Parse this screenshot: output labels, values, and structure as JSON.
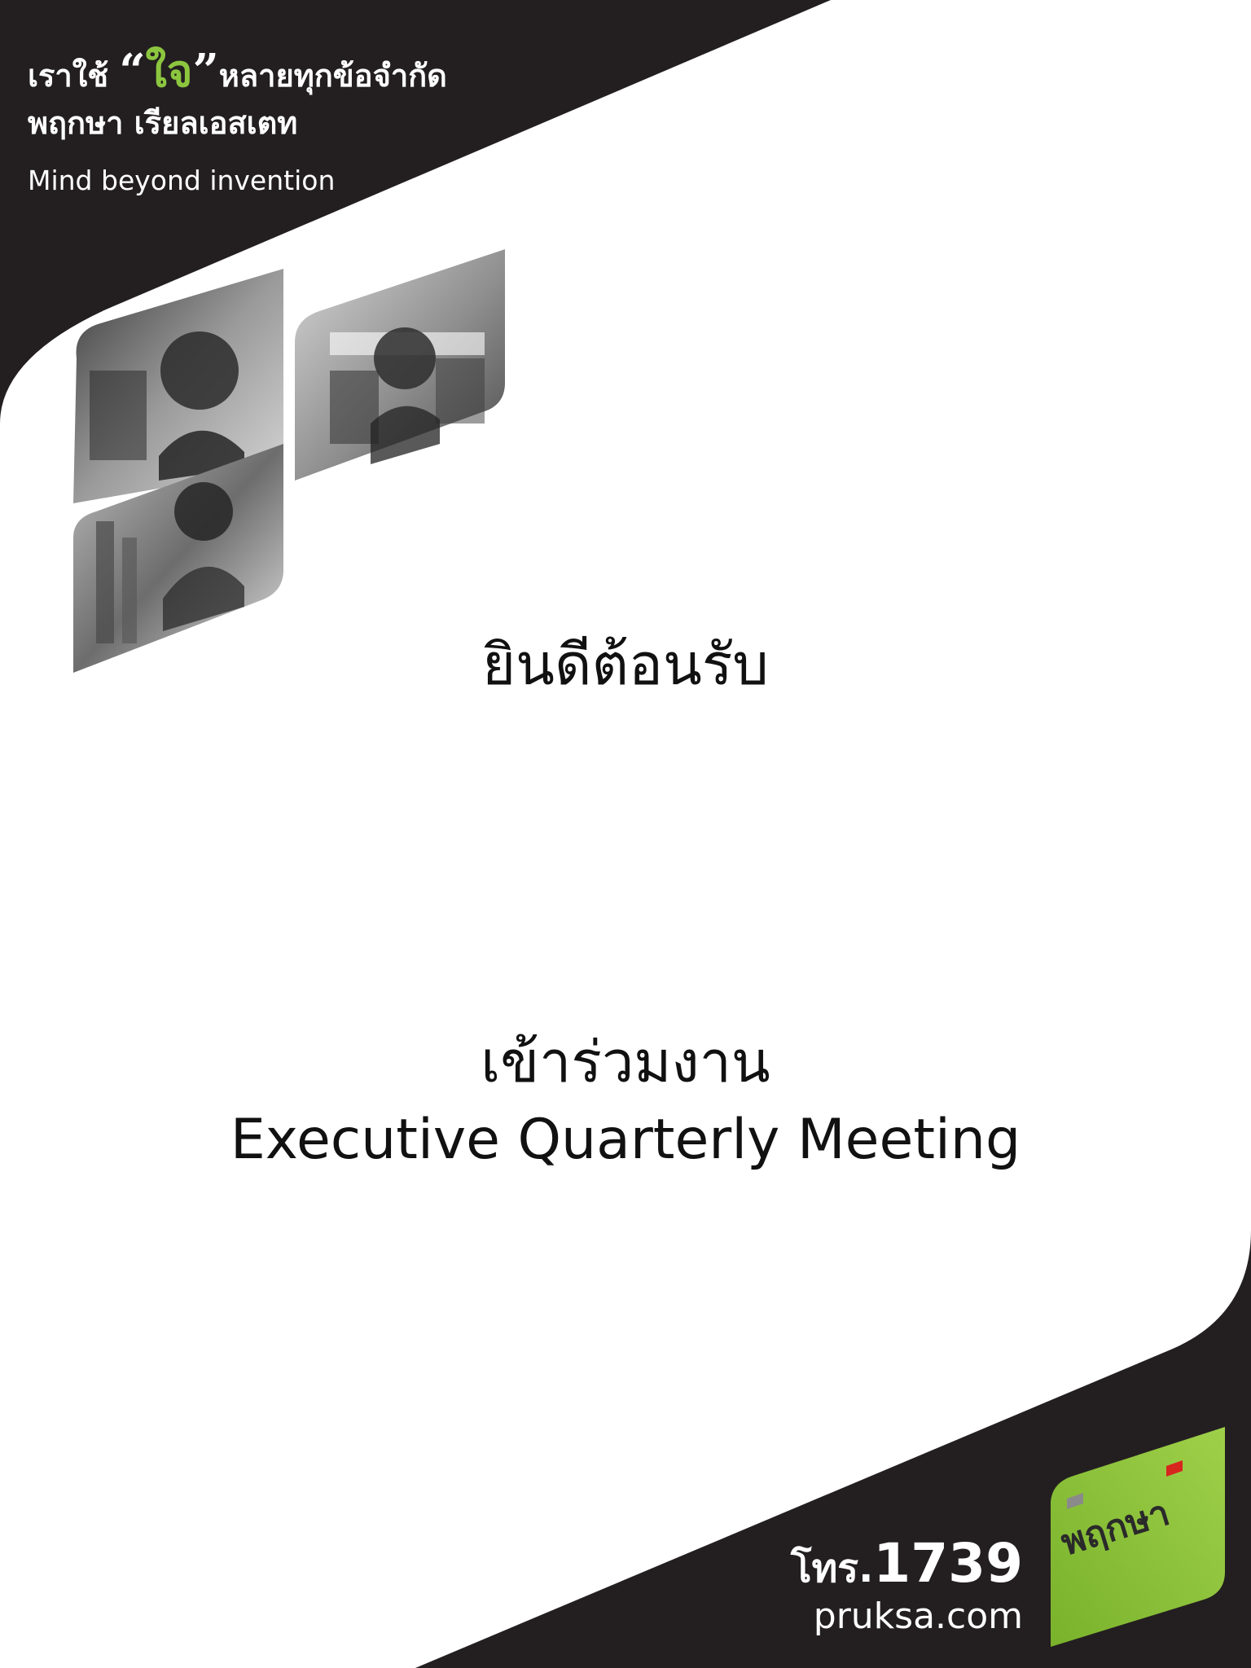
{
  "slogan": {
    "line1_before": "เราใช้",
    "open_quote": "“",
    "highlight": "ใจ",
    "close_quote": "”",
    "line1_after": "หลายทุกข้อจำกัด",
    "line2": "พฤกษา เรียลเอสเตท",
    "tagline": "Mind beyond invention"
  },
  "welcome": "ยินดีต้อนรับ",
  "invitation": {
    "line1": "เข้าร่วมงาน",
    "line2": "Executive Quarterly Meeting"
  },
  "footer": {
    "phone_prefix": "โทร.",
    "phone_number": "1739",
    "website": "pruksa.com"
  },
  "logo": {
    "wordmark": "พฤกษา"
  },
  "colors": {
    "dark_band": "#231f20",
    "brand_green": "#8cc63f",
    "logo_red": "#d7261e",
    "logo_grey": "#8a8a8a",
    "text": "#111111"
  }
}
